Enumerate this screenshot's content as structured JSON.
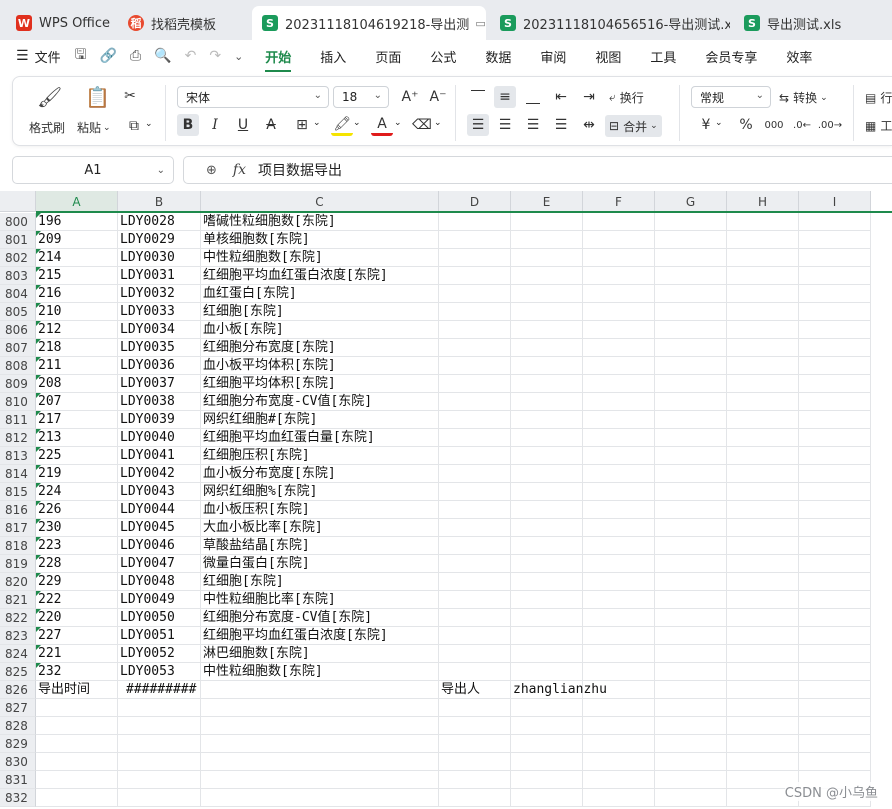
{
  "tabs": [
    {
      "label": "WPS Office",
      "icon": "wps-logo-icon",
      "active": false
    },
    {
      "label": "找稻壳模板",
      "icon": "daoke-icon",
      "active": false
    },
    {
      "label": "20231118104619218-导出测",
      "icon": "spreadsheet-icon",
      "active": true
    },
    {
      "label": "20231118104656516-导出测试.xls",
      "icon": "spreadsheet-icon",
      "active": false
    },
    {
      "label": "导出测试.xls",
      "icon": "spreadsheet-icon",
      "active": false
    }
  ],
  "menu": {
    "file_label": "文件",
    "tabs": [
      "开始",
      "插入",
      "页面",
      "公式",
      "数据",
      "审阅",
      "视图",
      "工具",
      "会员专享",
      "效率"
    ],
    "active_tab": "开始"
  },
  "ribbon": {
    "format_painter": "格式刷",
    "paste": "粘贴",
    "font_name": "宋体",
    "font_size": "18",
    "wrap_text": "换行",
    "merge": "合并",
    "number_format": "常规",
    "convert": "转换",
    "row_col_partial": "行",
    "worksheet_partial": "工"
  },
  "formula_bar": {
    "cell_ref": "A1",
    "fx_label": "fx",
    "content": "项目数据导出"
  },
  "columns": [
    "A",
    "B",
    "C",
    "D",
    "E",
    "F",
    "G",
    "H",
    "I"
  ],
  "rows": [
    {
      "num": "800",
      "a": "196",
      "b": "LDY0028",
      "c": "嗜碱性粒细胞数[东院]"
    },
    {
      "num": "801",
      "a": "209",
      "b": "LDY0029",
      "c": "单核细胞数[东院]"
    },
    {
      "num": "802",
      "a": "214",
      "b": "LDY0030",
      "c": "中性粒细胞数[东院]"
    },
    {
      "num": "803",
      "a": "215",
      "b": "LDY0031",
      "c": "红细胞平均血红蛋白浓度[东院]"
    },
    {
      "num": "804",
      "a": "216",
      "b": "LDY0032",
      "c": "血红蛋白[东院]"
    },
    {
      "num": "805",
      "a": "210",
      "b": "LDY0033",
      "c": "红细胞[东院]"
    },
    {
      "num": "806",
      "a": "212",
      "b": "LDY0034",
      "c": "血小板[东院]"
    },
    {
      "num": "807",
      "a": "218",
      "b": "LDY0035",
      "c": "红细胞分布宽度[东院]"
    },
    {
      "num": "808",
      "a": "211",
      "b": "LDY0036",
      "c": "血小板平均体积[东院]"
    },
    {
      "num": "809",
      "a": "208",
      "b": "LDY0037",
      "c": "红细胞平均体积[东院]"
    },
    {
      "num": "810",
      "a": "207",
      "b": "LDY0038",
      "c": "红细胞分布宽度-CV值[东院]"
    },
    {
      "num": "811",
      "a": "217",
      "b": "LDY0039",
      "c": "网织红细胞#[东院]"
    },
    {
      "num": "812",
      "a": "213",
      "b": "LDY0040",
      "c": "红细胞平均血红蛋白量[东院]"
    },
    {
      "num": "813",
      "a": "225",
      "b": "LDY0041",
      "c": "红细胞压积[东院]"
    },
    {
      "num": "814",
      "a": "219",
      "b": "LDY0042",
      "c": "血小板分布宽度[东院]"
    },
    {
      "num": "815",
      "a": "224",
      "b": "LDY0043",
      "c": "网织红细胞%[东院]"
    },
    {
      "num": "816",
      "a": "226",
      "b": "LDY0044",
      "c": "血小板压积[东院]"
    },
    {
      "num": "817",
      "a": "230",
      "b": "LDY0045",
      "c": "大血小板比率[东院]"
    },
    {
      "num": "818",
      "a": "223",
      "b": "LDY0046",
      "c": "草酸盐结晶[东院]"
    },
    {
      "num": "819",
      "a": "228",
      "b": "LDY0047",
      "c": "微量白蛋白[东院]"
    },
    {
      "num": "820",
      "a": "229",
      "b": "LDY0048",
      "c": "红细胞[东院]"
    },
    {
      "num": "821",
      "a": "222",
      "b": "LDY0049",
      "c": "中性粒细胞比率[东院]"
    },
    {
      "num": "822",
      "a": "220",
      "b": "LDY0050",
      "c": "红细胞分布宽度-CV值[东院]"
    },
    {
      "num": "823",
      "a": "227",
      "b": "LDY0051",
      "c": "红细胞平均血红蛋白浓度[东院]"
    },
    {
      "num": "824",
      "a": "221",
      "b": "LDY0052",
      "c": "淋巴细胞数[东院]"
    },
    {
      "num": "825",
      "a": "232",
      "b": "LDY0053",
      "c": "中性粒细胞数[东院]"
    }
  ],
  "footer_row": {
    "num": "826",
    "a": "导出时间",
    "b": "#########",
    "d": "导出人",
    "e": "zhanglianzhu"
  },
  "empty_rows": [
    "827",
    "828",
    "829",
    "830",
    "831",
    "832"
  ],
  "watermark": "CSDN @小乌鱼",
  "colors": {
    "accent": "#1e8a4c",
    "header_bg": "#eceef1"
  }
}
